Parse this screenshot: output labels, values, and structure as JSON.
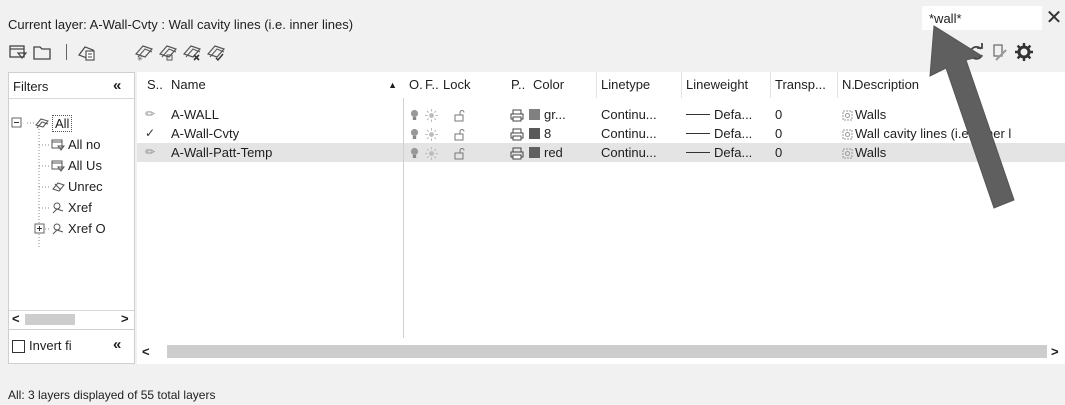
{
  "header": {
    "current_layer": "Current layer: A-Wall-Cvty : Wall cavity lines (i.e. inner lines)",
    "search_value": "*wall*",
    "close_label": "✕"
  },
  "toolbar": {
    "left_icons": [
      "new-property-filter-icon",
      "new-group-filter-icon",
      "layer-states-manager-icon",
      "new-layer-icon",
      "new-layer-vp-frozen-icon",
      "delete-layer-icon",
      "set-current-icon"
    ],
    "right_icons": [
      "refresh-icon",
      "settings-toggle-icon",
      "gear-icon"
    ]
  },
  "filters": {
    "title": "Filters",
    "collapse": "«",
    "tree": [
      {
        "label": "All"
      },
      {
        "label": "All no"
      },
      {
        "label": "All Us"
      },
      {
        "label": "Unrec"
      },
      {
        "label": "Xref"
      },
      {
        "label": "Xref O"
      }
    ],
    "invert_label": "Invert fi",
    "invert_collapse": "«"
  },
  "columns": [
    "S..",
    "Name",
    "O.",
    "F..",
    "Lock",
    "P..",
    "Color",
    "Linetype",
    "Lineweight",
    "Transp...",
    "N.",
    "Description"
  ],
  "sort_indicator": "▲",
  "layers": [
    {
      "status": "✏",
      "name": "A-WALL",
      "color_name": "gr...",
      "color_hex": "#808080",
      "linetype": "Continu...",
      "lineweight": "Defa...",
      "transparency": "0",
      "description": "Walls",
      "selected": false,
      "current": false
    },
    {
      "status": "✓",
      "name": "A-Wall-Cvty",
      "color_name": "8",
      "color_hex": "#595959",
      "linetype": "Continu...",
      "lineweight": "Defa...",
      "transparency": "0",
      "description": "Wall cavity lines (i.e. inner l",
      "selected": false,
      "current": true
    },
    {
      "status": "✏",
      "name": "A-Wall-Patt-Temp",
      "color_name": "red",
      "color_hex": "#606060",
      "linetype": "Continu...",
      "lineweight": "Defa...",
      "transparency": "0",
      "description": "Walls",
      "selected": true,
      "current": false
    }
  ],
  "scroll": {
    "left": "<",
    "right": ">"
  },
  "status_bar": "All: 3 layers displayed of 55 total layers"
}
